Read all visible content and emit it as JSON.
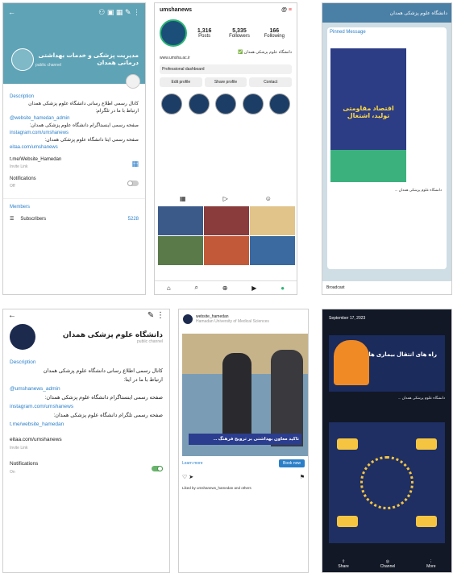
{
  "panel1": {
    "title": "مدیریت پزشکی و خدمات بهداشتی درمانی همدان",
    "subtitle": "public channel",
    "description_label": "Description",
    "desc_line1": "کانال رسمی اطلاع رسانی دانشگاه علوم پزشکی همدان",
    "contact_text": "ارتباط با ما در تلگرام:",
    "contact_link": "@website_hamedan_admin",
    "insta_text": "صفحه رسمی اینستاگرام دانشگاه علوم پزشکی همدان:",
    "insta_link": "instagram.com/umshanews",
    "eitaa_text": "صفحه رسمی ایتا دانشگاه علوم پزشکی همدان:",
    "eitaa_link": "eitaa.com/umshanews",
    "invite_link": "t.me/Website_Hamedan",
    "invite_label": "Invite Link",
    "notifications_label": "Notifications",
    "notifications_state": "Off",
    "members_label": "Members",
    "subscribers_label": "Subscribers",
    "subscribers_count": "5228"
  },
  "panel2": {
    "username": "umshanews",
    "posts": "1,316",
    "posts_label": "Posts",
    "followers": "5,335",
    "followers_label": "Followers",
    "following": "166",
    "following_label": "Following",
    "bio": "دانشگاه علوم پزشکی همدان ✅",
    "link": "www.umsha.ac.ir",
    "dashboard": "Professional dashboard",
    "btn1": "Edit profile",
    "btn2": "Share profile",
    "btn3": "Contact"
  },
  "panel3": {
    "channel": "دانشگاه علوم پزشکی همدان",
    "pinned": "Pinned Message",
    "poster_text": "اقتصاد مقاومتی تولید، اشتغال",
    "message": "دانشگاه علوم پزشکی همدان ...",
    "input": "Broadcast"
  },
  "panel4": {
    "title": "دانشگاه علوم پزشکی همدان",
    "subtitle": "public channel",
    "description_label": "Description",
    "desc_line1": "کانال رسمی اطلاع رسانی دانشگاه علوم پزشکی همدان",
    "contact_text": "ارتباط با ما در ایتا:",
    "contact_link": "@umshanews_admin",
    "insta_text": "صفحه رسمی اینستاگرام دانشگاه علوم پزشکی همدان:",
    "insta_link": "instagram.com/umshanews",
    "tg_text": "صفحه رسمی تلگرام دانشگاه علوم پزشکی همدان:",
    "tg_link": "t.me/website_hamedan",
    "invite_link": "eitaa.com/umshanews",
    "invite_label": "Invite Link",
    "notifications_label": "Notifications",
    "notifications_state": "On"
  },
  "panel5": {
    "account": "website_hamedan",
    "account_sub": "Hamadan University of Medical Sciences",
    "caption": "تاکید معاون بهداشتی بر ترویج فرهنگ ...",
    "learn_more": "Learn more",
    "book_now": "Book now",
    "likes": "Liked by umshanews_hamedan and others"
  },
  "panel6": {
    "date": "September 17, 2023",
    "hero_text": "راه های انتقال بیماری ها",
    "body": "دانشگاه علوم پزشکی همدان ...",
    "ctrl1": "Share",
    "ctrl2": "Channel",
    "ctrl3": "More"
  }
}
